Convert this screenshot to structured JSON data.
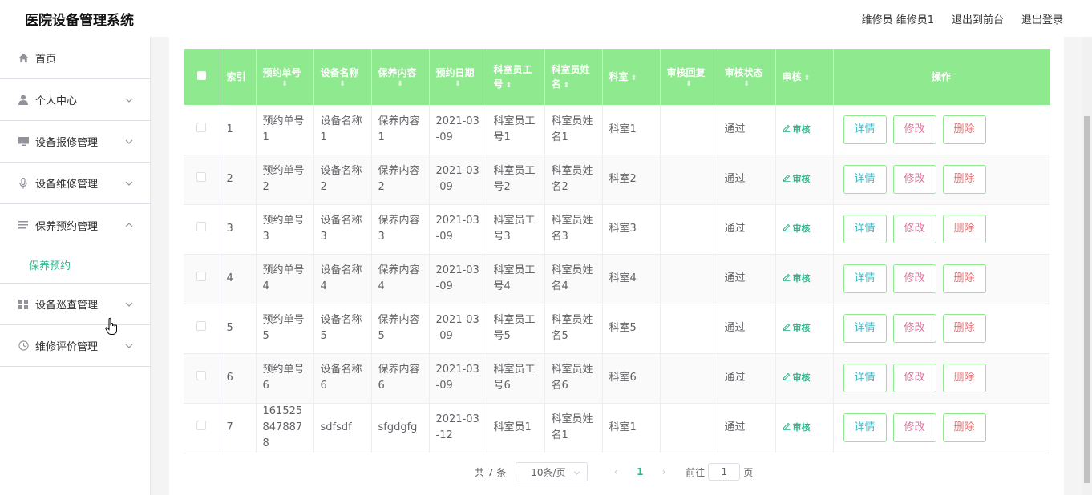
{
  "header": {
    "app_title": "医院设备管理系统",
    "user_label": "维修员 维修员1",
    "to_front_label": "退出到前台",
    "logout_label": "退出登录"
  },
  "sidebar": {
    "items": [
      {
        "label": "首页",
        "icon": "home-icon"
      },
      {
        "label": "个人中心",
        "icon": "user-icon"
      },
      {
        "label": "设备报修管理",
        "icon": "monitor-icon"
      },
      {
        "label": "设备维修管理",
        "icon": "microphone-icon"
      },
      {
        "label": "保养预约管理",
        "icon": "menu-lines-icon",
        "expanded": true
      },
      {
        "label": "设备巡查管理",
        "icon": "grid-icon"
      },
      {
        "label": "维修评价管理",
        "icon": "clock-icon"
      }
    ],
    "submenu_active": "保养预约"
  },
  "table": {
    "headers": [
      "索引",
      "预约单号",
      "设备名称",
      "保养内容",
      "预约日期",
      "科室员工号",
      "科室员姓名",
      "科室",
      "审核回复",
      "审核状态",
      "审核",
      "操作"
    ],
    "rows": [
      {
        "index": "1",
        "order_no": "预约单号1",
        "device": "设备名称1",
        "content": "保养内容1",
        "date": "2021-03-09",
        "emp_no": "科室员工号1",
        "emp_name": "科室员姓名1",
        "dept": "科室1",
        "reply": "",
        "status": "通过"
      },
      {
        "index": "2",
        "order_no": "预约单号2",
        "device": "设备名称2",
        "content": "保养内容2",
        "date": "2021-03-09",
        "emp_no": "科室员工号2",
        "emp_name": "科室员姓名2",
        "dept": "科室2",
        "reply": "",
        "status": "通过"
      },
      {
        "index": "3",
        "order_no": "预约单号3",
        "device": "设备名称3",
        "content": "保养内容3",
        "date": "2021-03-09",
        "emp_no": "科室员工号3",
        "emp_name": "科室员姓名3",
        "dept": "科室3",
        "reply": "",
        "status": "通过"
      },
      {
        "index": "4",
        "order_no": "预约单号4",
        "device": "设备名称4",
        "content": "保养内容4",
        "date": "2021-03-09",
        "emp_no": "科室员工号4",
        "emp_name": "科室员姓名4",
        "dept": "科室4",
        "reply": "",
        "status": "通过"
      },
      {
        "index": "5",
        "order_no": "预约单号5",
        "device": "设备名称5",
        "content": "保养内容5",
        "date": "2021-03-09",
        "emp_no": "科室员工号5",
        "emp_name": "科室员姓名5",
        "dept": "科室5",
        "reply": "",
        "status": "通过"
      },
      {
        "index": "6",
        "order_no": "预约单号6",
        "device": "设备名称6",
        "content": "保养内容6",
        "date": "2021-03-09",
        "emp_no": "科室员工号6",
        "emp_name": "科室员姓名6",
        "dept": "科室6",
        "reply": "",
        "status": "通过"
      },
      {
        "index": "7",
        "order_no": "1615258478878",
        "device": "sdfsdf",
        "content": "sfgdgfg",
        "date": "2021-03-12",
        "emp_no": "科室员1",
        "emp_name": "科室员姓名1",
        "dept": "科室1",
        "reply": "",
        "status": "通过"
      }
    ],
    "audit_label": "审核",
    "detail_label": "详情",
    "edit_label": "修改",
    "delete_label": "删除"
  },
  "pagination": {
    "total_label": "共 7 条",
    "page_size": "10条/页",
    "current_page": "1",
    "goto_prefix": "前往",
    "goto_value": "1",
    "goto_suffix": "页"
  },
  "colors": {
    "header_green": "#8fea8f",
    "accent": "#2fb78d"
  }
}
